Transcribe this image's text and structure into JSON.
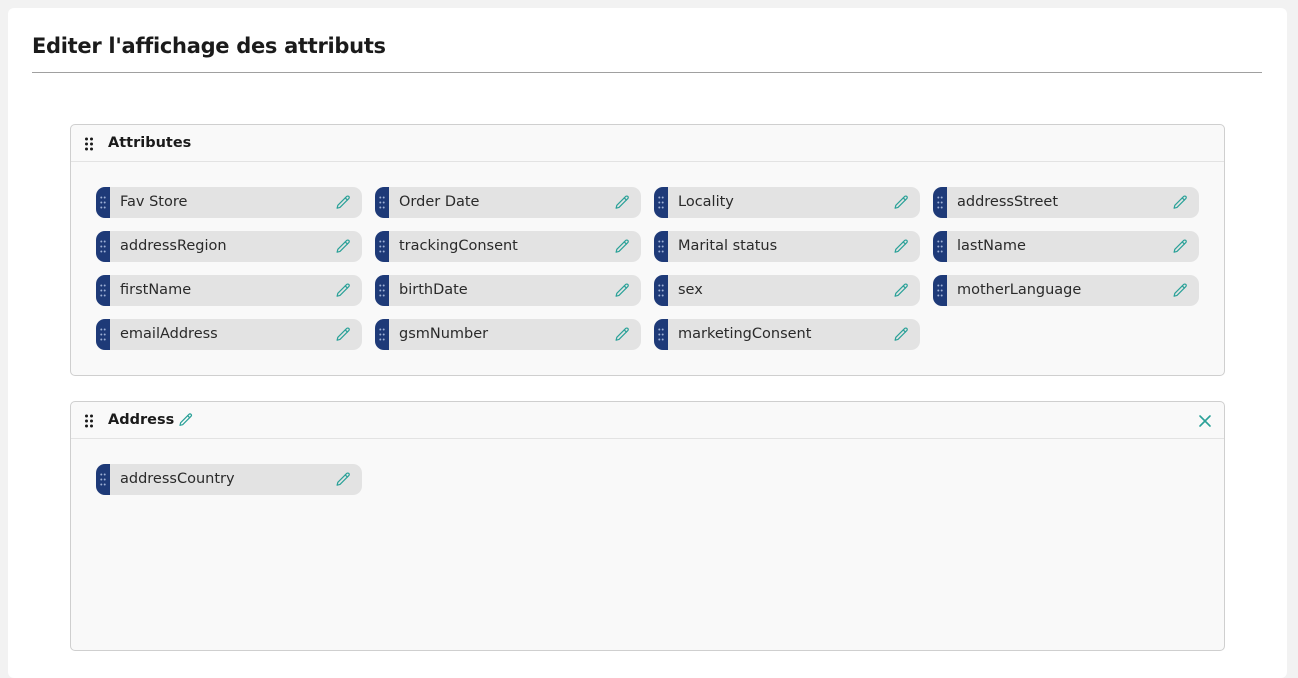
{
  "page": {
    "title": "Editer l'affichage des attributs"
  },
  "groups": [
    {
      "title": "Attributes",
      "editable": false,
      "closable": false,
      "attributes": [
        {
          "label": "Fav Store"
        },
        {
          "label": "Order Date"
        },
        {
          "label": "Locality"
        },
        {
          "label": "addressStreet"
        },
        {
          "label": "addressRegion"
        },
        {
          "label": "trackingConsent"
        },
        {
          "label": "Marital status"
        },
        {
          "label": "lastName"
        },
        {
          "label": "firstName"
        },
        {
          "label": "birthDate"
        },
        {
          "label": "sex"
        },
        {
          "label": "motherLanguage"
        },
        {
          "label": "emailAddress"
        },
        {
          "label": "gsmNumber"
        },
        {
          "label": "marketingConsent"
        }
      ]
    },
    {
      "title": "Address",
      "editable": true,
      "closable": true,
      "attributes": [
        {
          "label": "addressCountry"
        }
      ]
    }
  ],
  "icons": {
    "drag": "drag-handle-icon",
    "edit": "pencil-icon",
    "close": "close-icon"
  },
  "colors": {
    "accent": "#2aa198",
    "grip": "#1e3a78",
    "chip_bg": "#e3e3e3"
  }
}
